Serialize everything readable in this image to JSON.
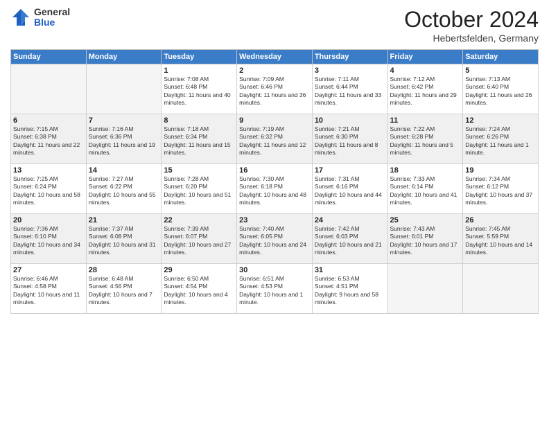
{
  "header": {
    "logo_general": "General",
    "logo_blue": "Blue",
    "month_title": "October 2024",
    "location": "Hebertsfelden, Germany"
  },
  "days_of_week": [
    "Sunday",
    "Monday",
    "Tuesday",
    "Wednesday",
    "Thursday",
    "Friday",
    "Saturday"
  ],
  "weeks": [
    [
      {
        "day": "",
        "info": ""
      },
      {
        "day": "",
        "info": ""
      },
      {
        "day": "1",
        "info": "Sunrise: 7:08 AM\nSunset: 6:48 PM\nDaylight: 11 hours and 40 minutes."
      },
      {
        "day": "2",
        "info": "Sunrise: 7:09 AM\nSunset: 6:46 PM\nDaylight: 11 hours and 36 minutes."
      },
      {
        "day": "3",
        "info": "Sunrise: 7:11 AM\nSunset: 6:44 PM\nDaylight: 11 hours and 33 minutes."
      },
      {
        "day": "4",
        "info": "Sunrise: 7:12 AM\nSunset: 6:42 PM\nDaylight: 11 hours and 29 minutes."
      },
      {
        "day": "5",
        "info": "Sunrise: 7:13 AM\nSunset: 6:40 PM\nDaylight: 11 hours and 26 minutes."
      }
    ],
    [
      {
        "day": "6",
        "info": "Sunrise: 7:15 AM\nSunset: 6:38 PM\nDaylight: 11 hours and 22 minutes."
      },
      {
        "day": "7",
        "info": "Sunrise: 7:16 AM\nSunset: 6:36 PM\nDaylight: 11 hours and 19 minutes."
      },
      {
        "day": "8",
        "info": "Sunrise: 7:18 AM\nSunset: 6:34 PM\nDaylight: 11 hours and 15 minutes."
      },
      {
        "day": "9",
        "info": "Sunrise: 7:19 AM\nSunset: 6:32 PM\nDaylight: 11 hours and 12 minutes."
      },
      {
        "day": "10",
        "info": "Sunrise: 7:21 AM\nSunset: 6:30 PM\nDaylight: 11 hours and 8 minutes."
      },
      {
        "day": "11",
        "info": "Sunrise: 7:22 AM\nSunset: 6:28 PM\nDaylight: 11 hours and 5 minutes."
      },
      {
        "day": "12",
        "info": "Sunrise: 7:24 AM\nSunset: 6:26 PM\nDaylight: 11 hours and 1 minute."
      }
    ],
    [
      {
        "day": "13",
        "info": "Sunrise: 7:25 AM\nSunset: 6:24 PM\nDaylight: 10 hours and 58 minutes."
      },
      {
        "day": "14",
        "info": "Sunrise: 7:27 AM\nSunset: 6:22 PM\nDaylight: 10 hours and 55 minutes."
      },
      {
        "day": "15",
        "info": "Sunrise: 7:28 AM\nSunset: 6:20 PM\nDaylight: 10 hours and 51 minutes."
      },
      {
        "day": "16",
        "info": "Sunrise: 7:30 AM\nSunset: 6:18 PM\nDaylight: 10 hours and 48 minutes."
      },
      {
        "day": "17",
        "info": "Sunrise: 7:31 AM\nSunset: 6:16 PM\nDaylight: 10 hours and 44 minutes."
      },
      {
        "day": "18",
        "info": "Sunrise: 7:33 AM\nSunset: 6:14 PM\nDaylight: 10 hours and 41 minutes."
      },
      {
        "day": "19",
        "info": "Sunrise: 7:34 AM\nSunset: 6:12 PM\nDaylight: 10 hours and 37 minutes."
      }
    ],
    [
      {
        "day": "20",
        "info": "Sunrise: 7:36 AM\nSunset: 6:10 PM\nDaylight: 10 hours and 34 minutes."
      },
      {
        "day": "21",
        "info": "Sunrise: 7:37 AM\nSunset: 6:08 PM\nDaylight: 10 hours and 31 minutes."
      },
      {
        "day": "22",
        "info": "Sunrise: 7:39 AM\nSunset: 6:07 PM\nDaylight: 10 hours and 27 minutes."
      },
      {
        "day": "23",
        "info": "Sunrise: 7:40 AM\nSunset: 6:05 PM\nDaylight: 10 hours and 24 minutes."
      },
      {
        "day": "24",
        "info": "Sunrise: 7:42 AM\nSunset: 6:03 PM\nDaylight: 10 hours and 21 minutes."
      },
      {
        "day": "25",
        "info": "Sunrise: 7:43 AM\nSunset: 6:01 PM\nDaylight: 10 hours and 17 minutes."
      },
      {
        "day": "26",
        "info": "Sunrise: 7:45 AM\nSunset: 5:59 PM\nDaylight: 10 hours and 14 minutes."
      }
    ],
    [
      {
        "day": "27",
        "info": "Sunrise: 6:46 AM\nSunset: 4:58 PM\nDaylight: 10 hours and 11 minutes."
      },
      {
        "day": "28",
        "info": "Sunrise: 6:48 AM\nSunset: 4:56 PM\nDaylight: 10 hours and 7 minutes."
      },
      {
        "day": "29",
        "info": "Sunrise: 6:50 AM\nSunset: 4:54 PM\nDaylight: 10 hours and 4 minutes."
      },
      {
        "day": "30",
        "info": "Sunrise: 6:51 AM\nSunset: 4:53 PM\nDaylight: 10 hours and 1 minute."
      },
      {
        "day": "31",
        "info": "Sunrise: 6:53 AM\nSunset: 4:51 PM\nDaylight: 9 hours and 58 minutes."
      },
      {
        "day": "",
        "info": ""
      },
      {
        "day": "",
        "info": ""
      }
    ]
  ]
}
